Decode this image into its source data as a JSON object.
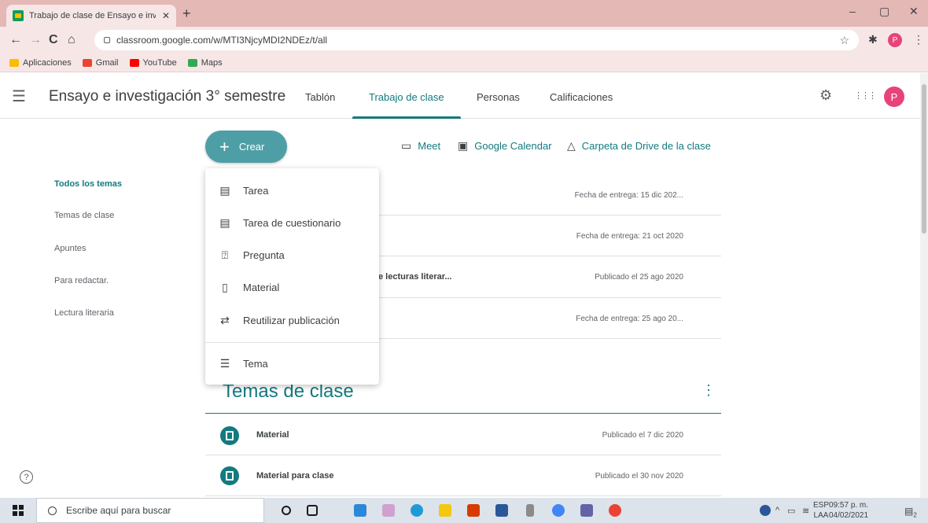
{
  "browser": {
    "tab_title": "Trabajo de clase de Ensayo e inve",
    "tab_close": "✕",
    "new_tab": "+",
    "url": "classroom.google.com/w/MTI3NjcyMDI2NDEz/t/all",
    "profile_initial": "P",
    "window_controls": {
      "minimize": "–",
      "maximize": "▢",
      "close": "✕"
    },
    "nav": {
      "back": "←",
      "forward": "→",
      "reload": "C",
      "home": "⌂"
    },
    "bookmarks": [
      {
        "label": "Aplicaciones",
        "icon": "apps-grid-icon",
        "color": "#fbbc04"
      },
      {
        "label": "Gmail",
        "icon": "gmail-icon",
        "color": "#ea4335"
      },
      {
        "label": "YouTube",
        "icon": "youtube-icon",
        "color": "#ff0000"
      },
      {
        "label": "Maps",
        "icon": "maps-icon",
        "color": "#34a853"
      }
    ]
  },
  "classroom": {
    "menu_icon": "☰",
    "course_title": "Ensayo e investigación 3° semestre",
    "tabs": [
      {
        "label": "Tablón"
      },
      {
        "label": "Trabajo de clase"
      },
      {
        "label": "Personas"
      },
      {
        "label": "Calificaciones"
      }
    ],
    "settings_icon": "⚙",
    "apps_icon": "⋮⋮⋮",
    "avatar_initial": "P",
    "accent_color": "#137a7f"
  },
  "toolbar": {
    "create_label": "Crear",
    "meet_label": "Meet",
    "calendar_label": "Google Calendar",
    "drive_label": "Carpeta de Drive de la clase"
  },
  "topics": [
    {
      "label": "Todos los temas"
    },
    {
      "label": "Temas de clase"
    },
    {
      "label": "Apuntes"
    },
    {
      "label": "Para redactar."
    },
    {
      "label": "Lectura literaria"
    }
  ],
  "work_items": [
    {
      "title": "",
      "date": "Fecha de entrega: 15 dic 202..."
    },
    {
      "title": "",
      "date": "Fecha de entrega: 21 oct 2020"
    },
    {
      "title": "e lecturas literar...",
      "date": "Publicado el 25 ago 2020"
    },
    {
      "title": "",
      "date": "Fecha de entrega: 25 ago 20..."
    }
  ],
  "create_menu": [
    {
      "label": "Tarea",
      "icon": "assignment-icon"
    },
    {
      "label": "Tarea de cuestionario",
      "icon": "quiz-assignment-icon"
    },
    {
      "label": "Pregunta",
      "icon": "question-icon"
    },
    {
      "label": "Material",
      "icon": "material-icon"
    },
    {
      "label": "Reutilizar publicación",
      "icon": "reuse-icon"
    },
    {
      "label": "Tema",
      "icon": "topic-icon"
    }
  ],
  "section": {
    "title": "Temas de clase",
    "menu": "⋮",
    "items": [
      {
        "title": "Material",
        "date": "Publicado el 7 dic 2020"
      },
      {
        "title": "Material para clase",
        "date": "Publicado el 30 nov 2020"
      }
    ]
  },
  "help": "?",
  "taskbar": {
    "search_placeholder": "Escribe aquí para buscar",
    "lang": "ESP",
    "lang_sub": "LAA",
    "time": "09:57 p. m.",
    "date": "04/02/2021",
    "notifications": "2"
  }
}
